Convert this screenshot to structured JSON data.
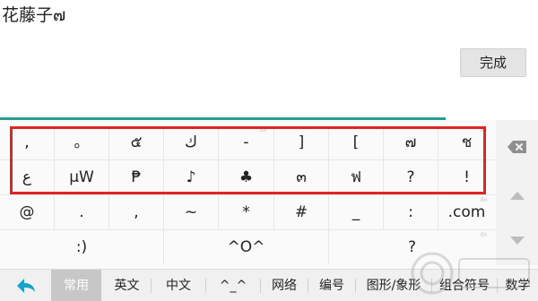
{
  "input": {
    "text": "花藤子๗"
  },
  "done_label": "完成",
  "symbols": {
    "row1": [
      ",",
      "。",
      "๕",
      "ك",
      "-",
      "]",
      "[",
      "๗",
      "ช"
    ],
    "row2": [
      "ع",
      "µW",
      "₱",
      "♪",
      "♣",
      "๓",
      "ฟ",
      "?",
      "!"
    ],
    "row3": [
      "@",
      ".",
      ",",
      "~",
      "*",
      "#",
      "_",
      ":",
      ".com"
    ],
    "row4": [
      ":)",
      "^O^",
      "?"
    ]
  },
  "corner_marks": {
    "en": "En"
  },
  "tabs": [
    "常用",
    "英文",
    "中文",
    "^_^",
    "网络",
    "编号",
    "图形/象形",
    "组合符号",
    "数学"
  ],
  "active_tab": "常用",
  "icons": {
    "delete": "backspace-icon",
    "up": "scroll-up-icon",
    "down": "scroll-down-icon",
    "back": "back-arrow-icon"
  },
  "colors": {
    "accent": "#2a9d8f",
    "highlight_box": "#e02424",
    "back_arrow": "#1aa3c9"
  }
}
